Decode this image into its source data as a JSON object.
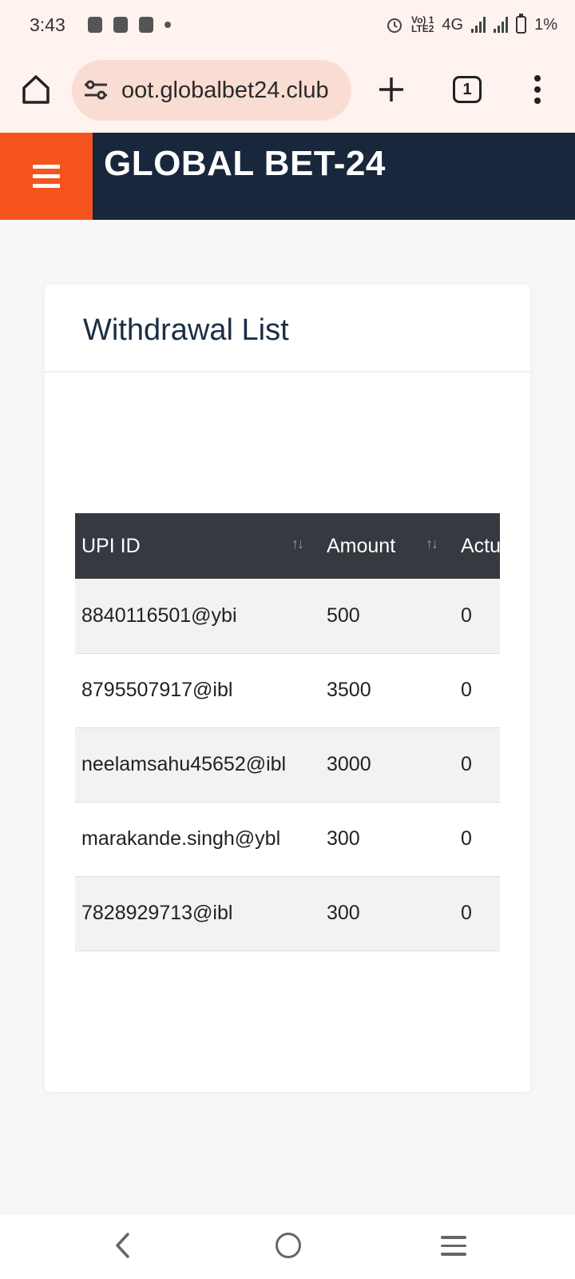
{
  "status_bar": {
    "time": "3:43",
    "network_top": "Vo) 1",
    "network_bottom": "LTE2",
    "network_type": "4G",
    "battery": "1%"
  },
  "browser": {
    "url": "oot.globalbet24.club",
    "tab_count": "1"
  },
  "app": {
    "brand": "GLOBAL BET-24"
  },
  "card": {
    "title": "Withdrawal List"
  },
  "table": {
    "headers": [
      "UPI ID",
      "Amount",
      "Actu"
    ],
    "sort_glyph": "↑↓",
    "rows": [
      {
        "upi": "8840116501@ybi",
        "amount": "500",
        "actual": "0"
      },
      {
        "upi": "8795507917@ibl",
        "amount": "3500",
        "actual": "0"
      },
      {
        "upi": "neelamsahu45652@ibl",
        "amount": "3000",
        "actual": "0"
      },
      {
        "upi": "marakande.singh@ybl",
        "amount": "300",
        "actual": "0"
      },
      {
        "upi": "7828929713@ibl",
        "amount": "300",
        "actual": "0"
      }
    ]
  },
  "colors": {
    "header_bg": "#18273b",
    "hamburger_bg": "#f5541d",
    "table_head_bg": "#343a40",
    "browser_bg": "#fff3ef"
  }
}
